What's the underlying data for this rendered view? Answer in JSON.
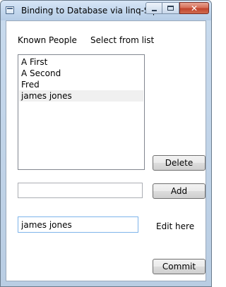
{
  "window": {
    "title": "Binding to Database via linq-Sql",
    "close_glyph": "✕"
  },
  "labels": {
    "known_people": "Known People",
    "select_from_list": "Select from list",
    "edit_here": "Edit here"
  },
  "people_list": {
    "items": [
      "A First",
      "A Second",
      "Fred",
      "james jones"
    ],
    "selected": "james jones"
  },
  "buttons": {
    "delete": "Delete",
    "add": "Add",
    "commit": "Commit"
  },
  "inputs": {
    "new_person_value": "",
    "edit_value": "james jones"
  },
  "colors": {
    "selection": "#f0f0f0",
    "close_button": "#c1452d"
  }
}
